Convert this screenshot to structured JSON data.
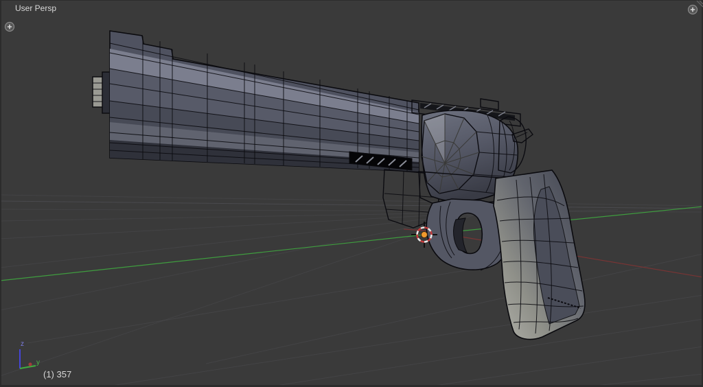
{
  "viewport": {
    "view_name": "User Persp",
    "object_info": "(1) 357",
    "axis_labels": {
      "y": "y",
      "z": "z"
    },
    "icons": {
      "expand_left": "plus-icon",
      "expand_right": "plus-icon",
      "corner": "resize-grip-icon"
    },
    "colors": {
      "background": "#3a3a3a",
      "border": "#2c2c2c",
      "grid_line": "#4a4a4e",
      "axis_x_line": "#7a3434",
      "axis_y_line": "#3f9e3f",
      "gizmo_x": "#a03c3c",
      "gizmo_y": "#3fae3f",
      "gizmo_z": "#4545d8",
      "label_y": "#4ab54a",
      "label_z": "#7d7de0",
      "cursor_ring_red": "#c43a3a",
      "cursor_ring_white": "#e8e8e8",
      "cursor_center": "#f09a2d",
      "text": "#d8d8d8"
    }
  }
}
